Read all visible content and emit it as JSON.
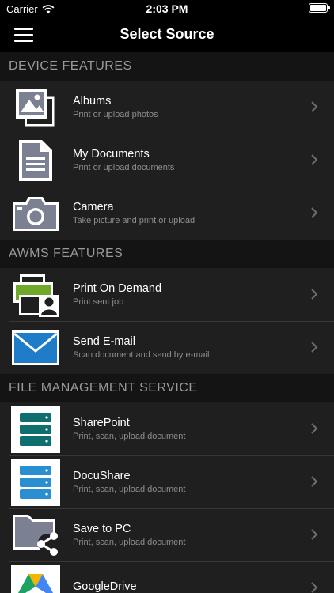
{
  "status_bar": {
    "carrier": "Carrier",
    "time": "2:03 PM"
  },
  "nav": {
    "title": "Select Source"
  },
  "sections": [
    {
      "title": "DEVICE FEATURES",
      "items": [
        {
          "title": "Albums",
          "subtitle": "Print or upload photos",
          "icon": "albums-icon"
        },
        {
          "title": "My Documents",
          "subtitle": "Print or upload documents",
          "icon": "document-icon"
        },
        {
          "title": "Camera",
          "subtitle": "Take picture and print or upload",
          "icon": "camera-icon"
        }
      ]
    },
    {
      "title": "AWMS FEATURES",
      "items": [
        {
          "title": "Print On Demand",
          "subtitle": "Print sent job",
          "icon": "printer-user-icon"
        },
        {
          "title": "Send E-mail",
          "subtitle": "Scan document and send by e-mail",
          "icon": "envelope-icon"
        }
      ]
    },
    {
      "title": "FILE MANAGEMENT SERVICE",
      "items": [
        {
          "title": "SharePoint",
          "subtitle": "Print, scan, upload document",
          "icon": "sharepoint-server-icon"
        },
        {
          "title": "DocuShare",
          "subtitle": "Print, scan, upload document",
          "icon": "docushare-server-icon"
        },
        {
          "title": "Save to PC",
          "subtitle": "Print, scan, upload document",
          "icon": "folder-share-icon"
        },
        {
          "title": "GoogleDrive",
          "subtitle": "",
          "icon": "google-drive-icon"
        }
      ]
    }
  ],
  "colors": {
    "background": "#000000",
    "row_background": "#1f1f1f",
    "section_header_bg": "#141414",
    "section_header_text": "#9a9a9a",
    "subtitle_text": "#8e8e8e",
    "icon_gray": "#7b8192",
    "printer_green": "#6fa82a",
    "email_blue": "#1f7cc8",
    "sharepoint_teal": "#0f6f6f",
    "docushare_blue": "#2a8fd0"
  }
}
